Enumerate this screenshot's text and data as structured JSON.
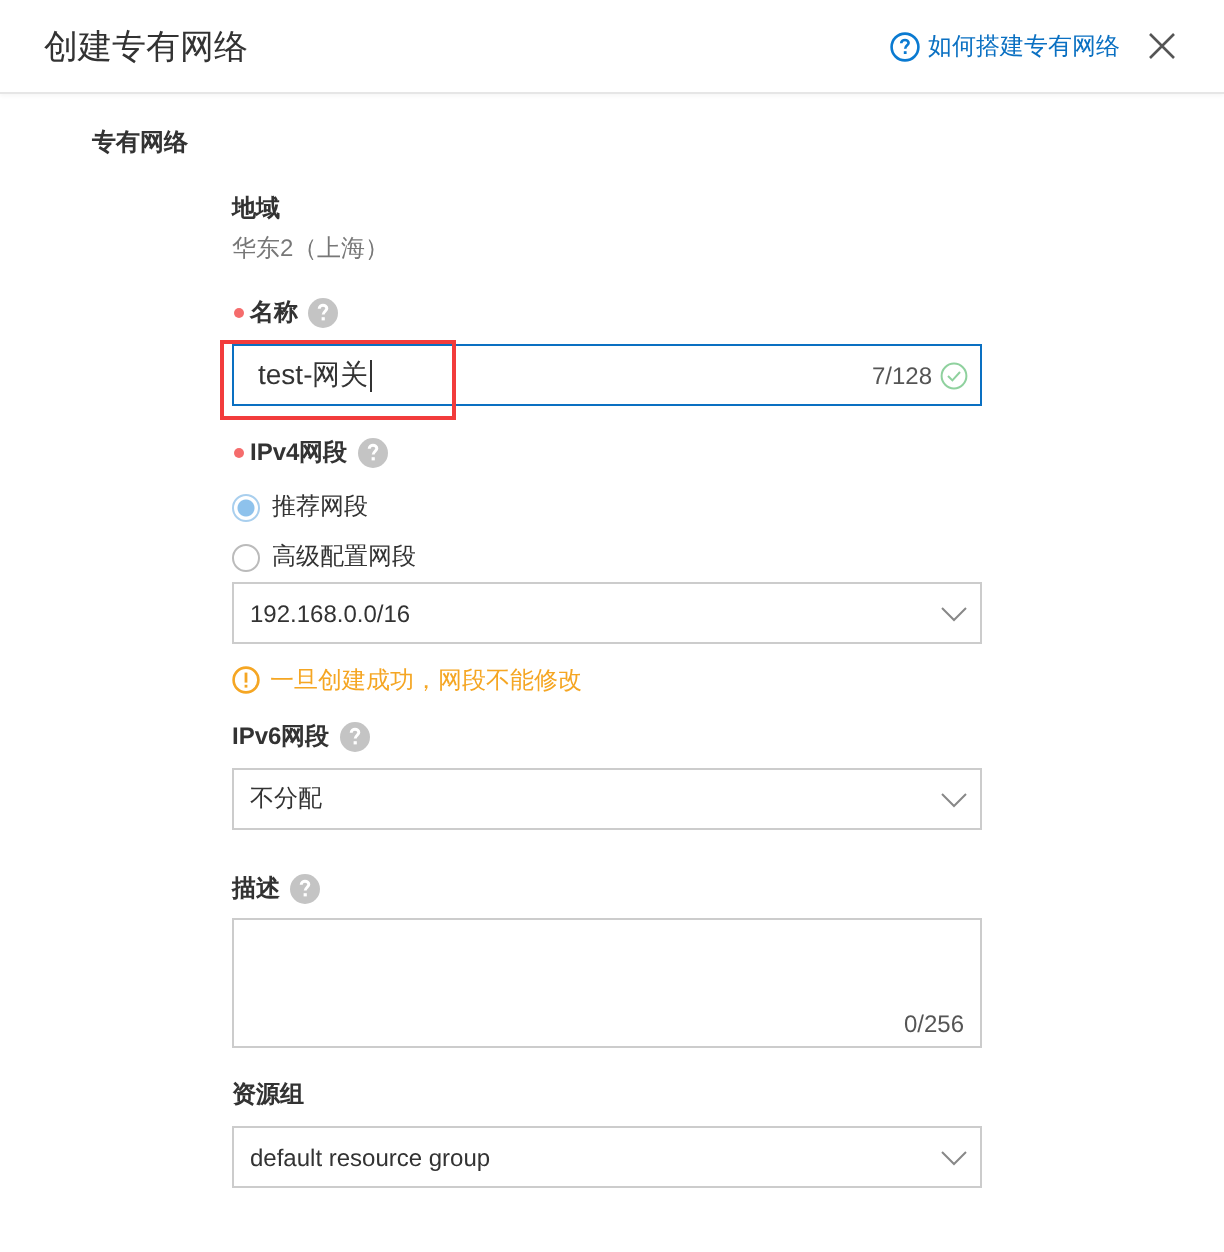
{
  "header": {
    "title": "创建专有网络",
    "help_link": "如何搭建专有网络"
  },
  "section": {
    "title": "专有网络"
  },
  "fields": [
    {
      "kind": "static",
      "label": "地域",
      "required": false,
      "help": false,
      "value": "华东2（上海）"
    },
    {
      "kind": "text",
      "label": "名称",
      "required": true,
      "help": true,
      "value": "test-网关",
      "counter": "7/128",
      "valid": true,
      "focused": true,
      "highlighted": true
    },
    {
      "kind": "radio_select",
      "label": "IPv4网段",
      "required": true,
      "help": true,
      "options": [
        {
          "label": "推荐网段",
          "selected": true
        },
        {
          "label": "高级配置网段",
          "selected": false
        }
      ],
      "value": "192.168.0.0/16",
      "warning": "一旦创建成功，网段不能修改"
    },
    {
      "kind": "select",
      "label": "IPv6网段",
      "required": false,
      "help": true,
      "value": "不分配"
    },
    {
      "kind": "textarea",
      "label": "描述",
      "required": false,
      "help": true,
      "counter": "0/256"
    },
    {
      "kind": "select",
      "label": "资源组",
      "required": false,
      "help": false,
      "value": "default resource group"
    }
  ]
}
